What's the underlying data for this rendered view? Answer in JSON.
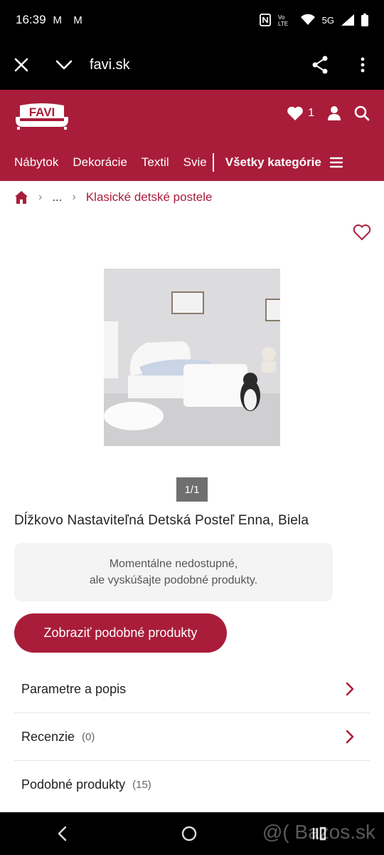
{
  "status": {
    "time": "16:39",
    "mail_icons": "M M",
    "network": "5G"
  },
  "browser": {
    "url": "favi.sk"
  },
  "header": {
    "logo_text": "FAVI",
    "favorites_count": "1",
    "nav": [
      "Nábytok",
      "Dekorácie",
      "Textil",
      "Svie"
    ],
    "all_categories": "Všetky kategórie"
  },
  "breadcrumb": {
    "ellipsis": "...",
    "current": "Klasické detské postele"
  },
  "product": {
    "image_counter": "1/1",
    "title": "Dĺžkovo Nastaviteľná Detská Posteľ Enna, Biela",
    "notice_line1": "Momentálne nedostupné,",
    "notice_line2": "ale vyskúšajte podobné produkty.",
    "cta": "Zobraziť podobné produkty"
  },
  "sections": [
    {
      "label": "Parametre a popis",
      "count": ""
    },
    {
      "label": "Recenzie",
      "count": "(0)"
    },
    {
      "label": "Podobné produkty",
      "count": "(15)"
    }
  ],
  "watermark": "@( Bazos.sk",
  "colors": {
    "brand": "#a91d3a"
  }
}
